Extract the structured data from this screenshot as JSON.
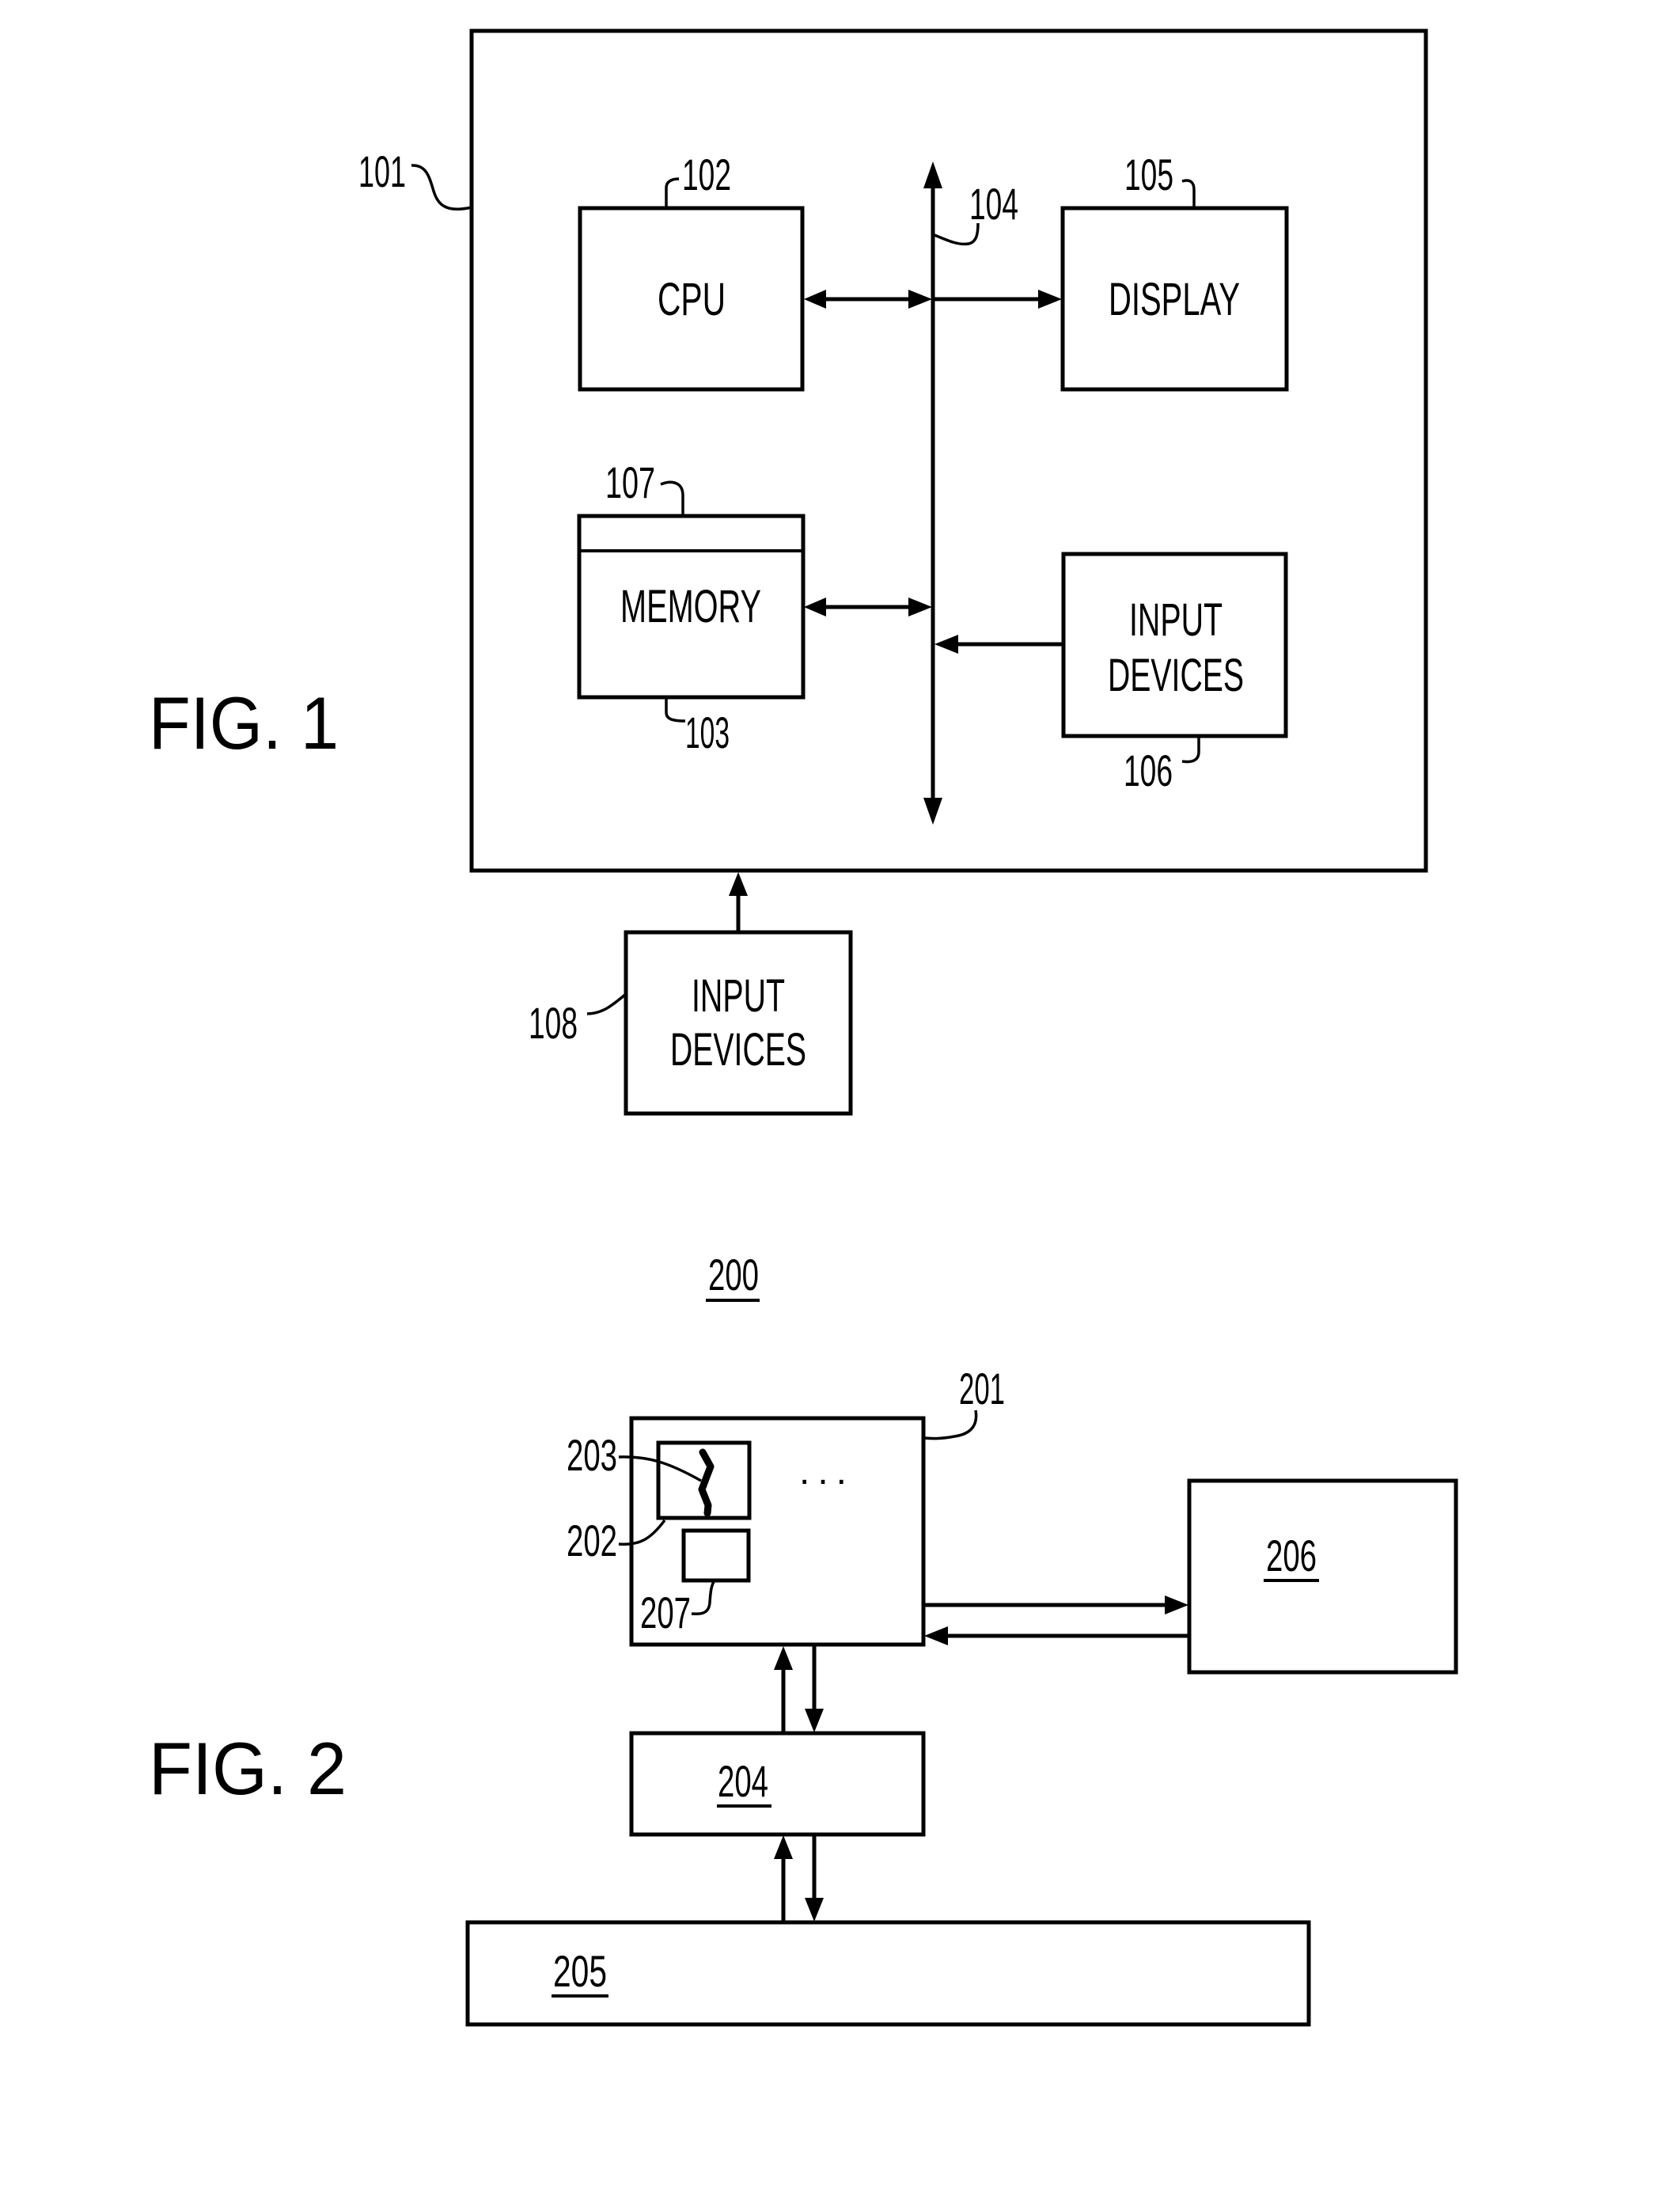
{
  "figure1": {
    "caption": "FIG. 1",
    "system_ref": "101",
    "cpu": {
      "label": "CPU",
      "ref": "102"
    },
    "memory": {
      "label": "MEMORY",
      "ref": "103",
      "sub_ref": "107"
    },
    "bus": {
      "ref": "104"
    },
    "display": {
      "label": "DISPLAY",
      "ref": "105"
    },
    "internal_input_devices": {
      "label_line1": "INPUT",
      "label_line2": "DEVICES",
      "ref": "106"
    },
    "external_input_devices": {
      "label_line1": "INPUT",
      "label_line2": "DEVICES",
      "ref": "108"
    }
  },
  "figure2": {
    "caption": "FIG. 2",
    "system_ref": "200",
    "device": {
      "ref": "201",
      "ellipsis": "..."
    },
    "element_202": {
      "ref": "202"
    },
    "element_203": {
      "ref": "203"
    },
    "element_207": {
      "ref": "207"
    },
    "block_204": {
      "ref": "204"
    },
    "block_205": {
      "ref": "205"
    },
    "block_206": {
      "ref": "206"
    }
  }
}
